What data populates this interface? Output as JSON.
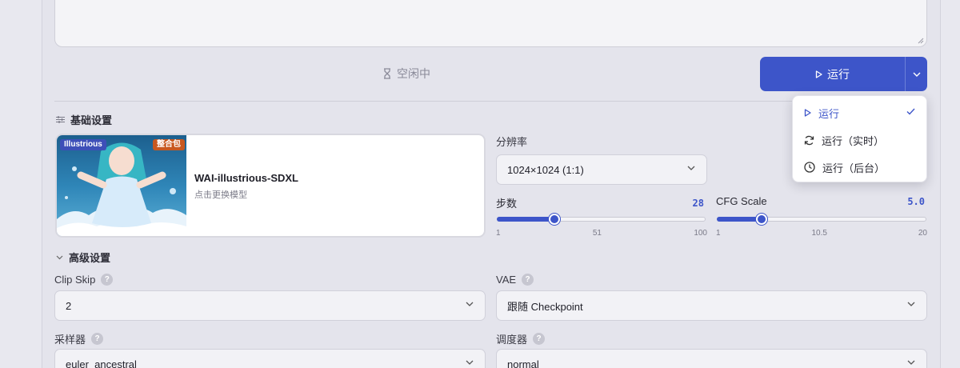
{
  "status": {
    "text": "空闲中",
    "icon": "hourglass-icon"
  },
  "run_button": {
    "label": "运行",
    "icon": "play-icon",
    "dropdown_icon": "chevron-down-icon",
    "color": "#3d55c9"
  },
  "run_menu": [
    {
      "label": "运行",
      "icon": "play-icon",
      "selected": true
    },
    {
      "label": "运行（实时）",
      "icon": "refresh-icon",
      "selected": false
    },
    {
      "label": "运行（后台）",
      "icon": "clock-icon",
      "selected": false
    }
  ],
  "basic": {
    "title": "基础设置",
    "model": {
      "name": "WAI-illustrious-SDXL",
      "subtitle": "点击更换模型",
      "badge_left": "Illustrious",
      "badge_right": "整合包"
    },
    "resolution": {
      "label": "分辨率",
      "value": "1024×1024 (1:1)"
    },
    "steps": {
      "label": "步数",
      "value": "28",
      "min": "1",
      "mid": "51",
      "max": "100",
      "fraction": 0.2727
    },
    "cfg": {
      "label": "CFG Scale",
      "value": "5.0",
      "min": "1",
      "mid": "10.5",
      "max": "20",
      "fraction": 0.2105
    }
  },
  "advanced": {
    "title": "高级设置",
    "clip_skip": {
      "label": "Clip Skip",
      "value": "2"
    },
    "vae": {
      "label": "VAE",
      "value": "跟随 Checkpoint"
    },
    "sampler": {
      "label": "采样器",
      "value": "euler_ancestral"
    },
    "scheduler": {
      "label": "调度器",
      "value": "normal"
    }
  }
}
